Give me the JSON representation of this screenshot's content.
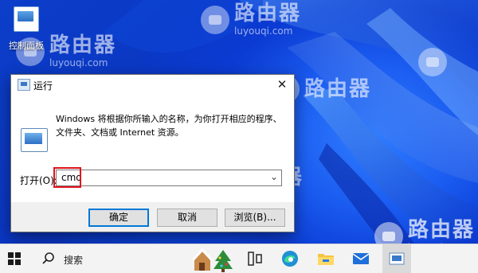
{
  "desktop": {
    "icon_label": "控制面板"
  },
  "watermark": {
    "brand": "路由器",
    "domain": "luyouqi.com"
  },
  "run_dialog": {
    "title": "运行",
    "description_line1": "Windows 将根据你所输入的名称，为你打开相应的程序、",
    "description_line2": "文件夹、文档或 Internet 资源。",
    "open_label": "打开(O):",
    "open_value": "cmd",
    "buttons": {
      "ok": "确定",
      "cancel": "取消",
      "browse": "浏览(B)..."
    }
  },
  "taskbar": {
    "search_label": "搜索"
  },
  "colors": {
    "highlight_box": "#e0141b",
    "primary_button_border": "#0078d7",
    "wallpaper": "#0a3fd6"
  }
}
